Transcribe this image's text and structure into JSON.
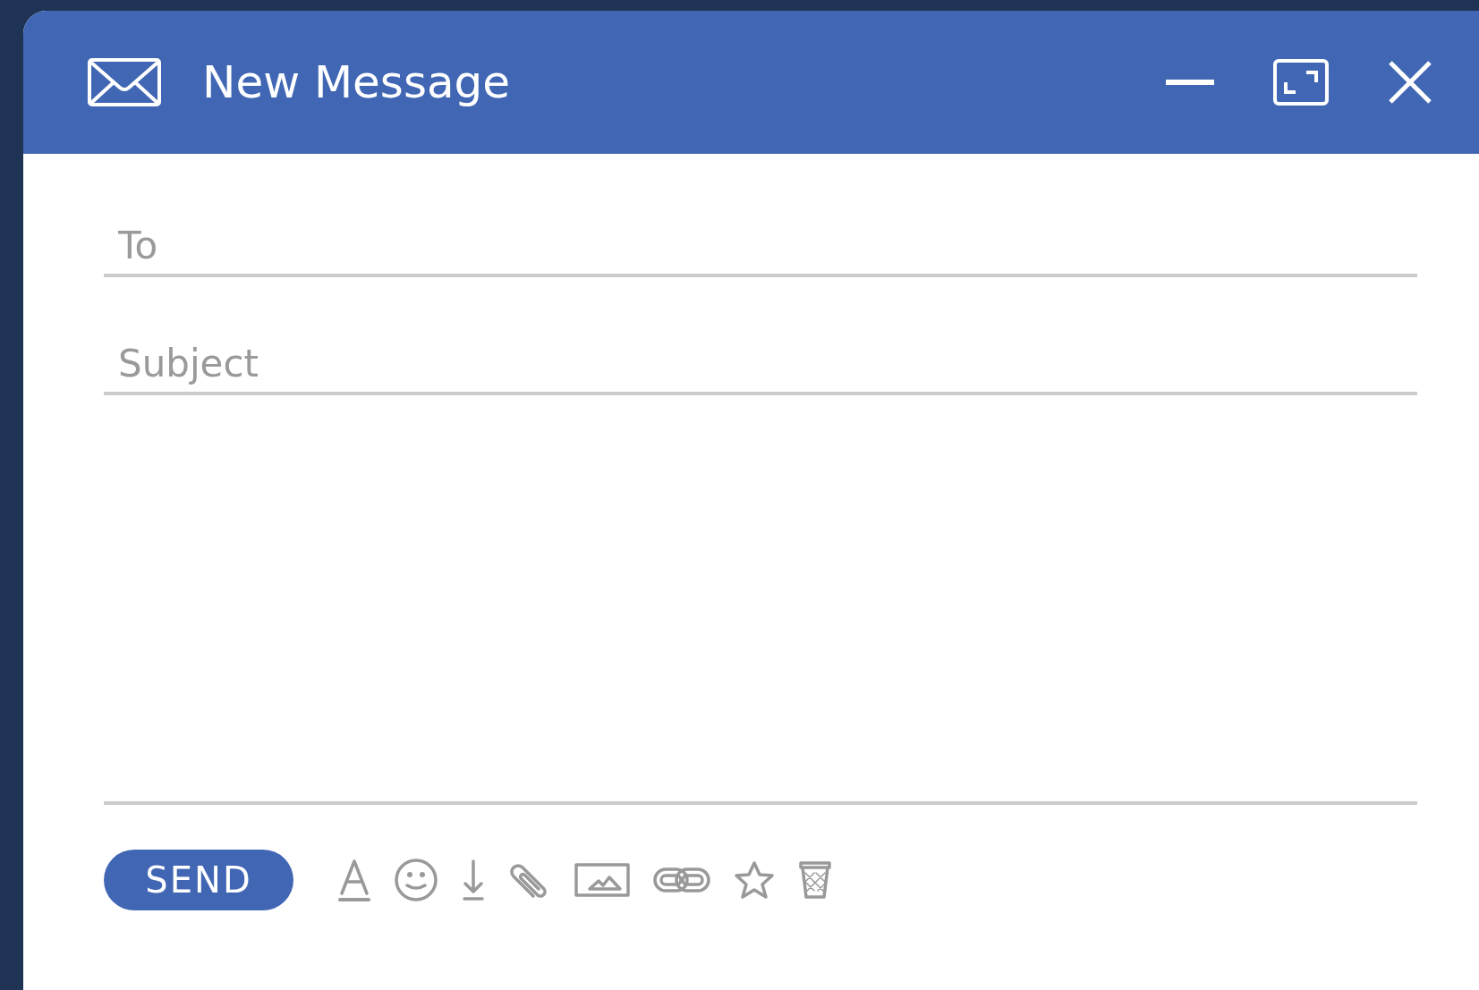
{
  "window": {
    "title": "New Message"
  },
  "fields": [
    {
      "kind": "line",
      "placeholder": "To"
    },
    {
      "kind": "line",
      "placeholder": "Subject"
    },
    {
      "kind": "body"
    }
  ],
  "send_button": {
    "label": "SEND"
  },
  "toolbar": [
    {
      "kind": "format"
    },
    {
      "kind": "emoji"
    },
    {
      "kind": "download"
    },
    {
      "kind": "attach"
    },
    {
      "kind": "image"
    },
    {
      "kind": "link"
    },
    {
      "kind": "star"
    },
    {
      "kind": "trash"
    }
  ]
}
